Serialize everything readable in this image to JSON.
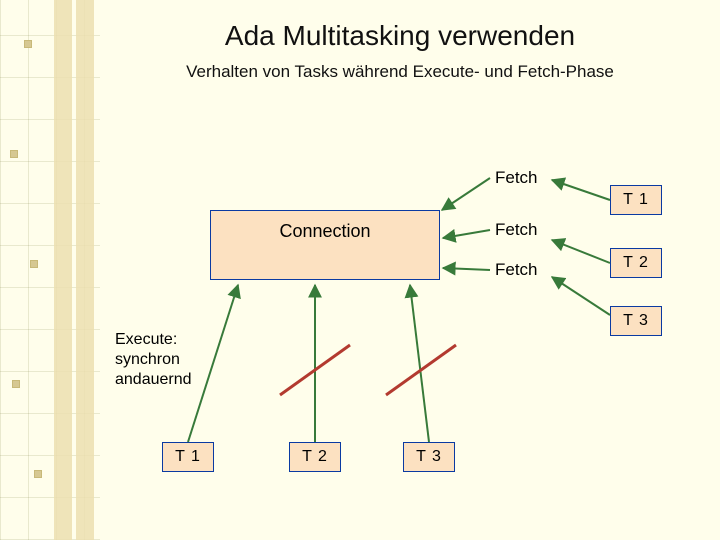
{
  "slide": {
    "title": "Ada Multitasking verwenden",
    "subtitle": "Verhalten von Tasks während Execute- und Fetch-Phase",
    "connection_label": "Connection",
    "fetch_labels": {
      "f1": "Fetch",
      "f2": "Fetch",
      "f3": "Fetch"
    },
    "execute_caption": {
      "line1": "Execute:",
      "line2": "synchron",
      "line3": "andauernd"
    },
    "tasks_right": {
      "t1": "T 1",
      "t2": "T 2",
      "t3": "T 3"
    },
    "tasks_bottom": {
      "t1": "T 1",
      "t2": "T 2",
      "t3": "T 3"
    }
  },
  "colors": {
    "background": "#FFFEEB",
    "box_fill": "#FCE1C1",
    "box_border": "#0a3aa2",
    "arrow_execute": "#387a3a",
    "arrow_fetch": "#387a3a",
    "blocked_slash": "#b33a2f"
  },
  "semantics": {
    "right_boxes": "Tasks T1..T3 pointing to Fetch labels then to the Connection box (Fetch phase)",
    "bottom_boxes": "Tasks T1..T3 with upward arrows to the Connection box (Execute phase)",
    "red_slashes": "T2 and T3 execute arrows are crossed out (blocked while T1 executes synchronously)"
  }
}
